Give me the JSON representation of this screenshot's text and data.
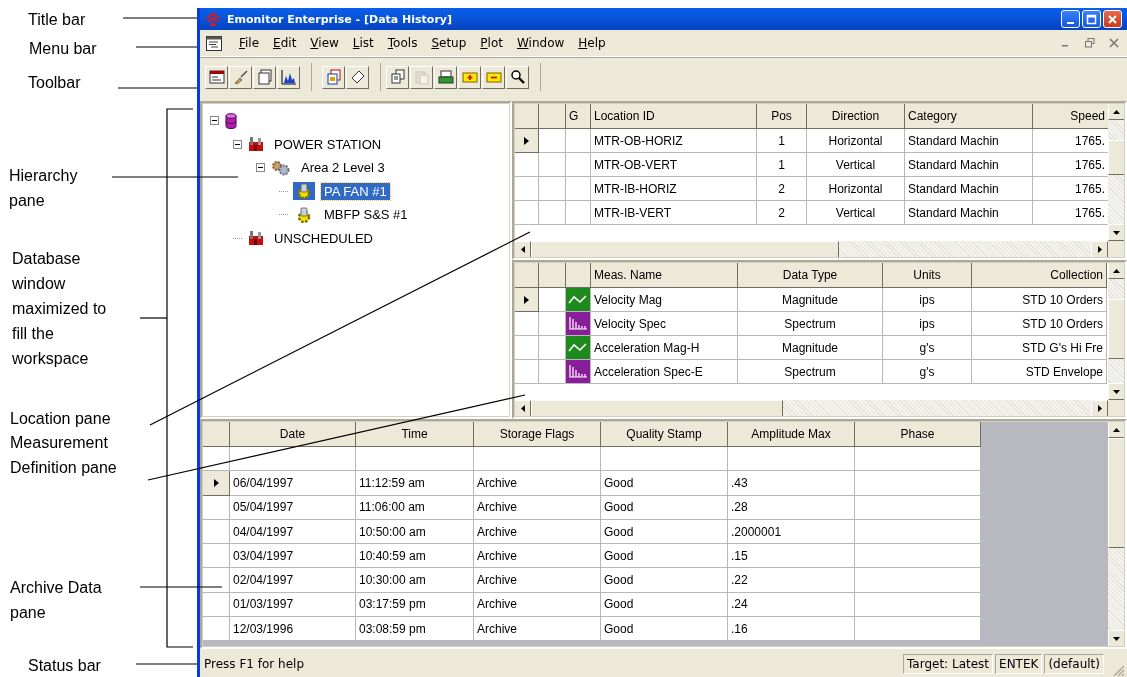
{
  "annotations": [
    {
      "label": "Title bar"
    },
    {
      "label": "Menu bar"
    },
    {
      "label": "Toolbar"
    },
    {
      "label": "Hierarchy pane"
    },
    {
      "label": "Database window maximized to fill the workspace"
    },
    {
      "label": "Location pane"
    },
    {
      "label": "Measurement Definition pane"
    },
    {
      "label": "Archive Data pane"
    },
    {
      "label": "Status bar"
    }
  ],
  "window": {
    "title": "Emonitor Enterprise - [Data History]"
  },
  "menu": [
    {
      "label": "File"
    },
    {
      "label": "Edit"
    },
    {
      "label": "View"
    },
    {
      "label": "List"
    },
    {
      "label": "Tools"
    },
    {
      "label": "Setup"
    },
    {
      "label": "Plot"
    },
    {
      "label": "Window"
    },
    {
      "label": "Help"
    }
  ],
  "toolbar": {
    "groups": [
      {
        "buttons": [
          {
            "disabled": false
          },
          {
            "disabled": false
          },
          {
            "disabled": false
          },
          {
            "disabled": false
          }
        ]
      },
      {
        "buttons": [
          {
            "disabled": false
          },
          {
            "disabled": false
          }
        ]
      },
      {
        "buttons": [
          {
            "disabled": false
          },
          {
            "disabled": true
          },
          {
            "disabled": false
          },
          {
            "disabled": false
          },
          {
            "disabled": false
          },
          {
            "disabled": false
          }
        ]
      }
    ]
  },
  "tree": {
    "nodes": [
      {
        "kind": "database",
        "expanded": true,
        "selected": false,
        "children": [
          {
            "label": "POWER STATION",
            "kind": "plant",
            "expanded": true,
            "selected": false,
            "children": [
              {
                "label": "Area 2 Level 3",
                "kind": "area",
                "expanded": true,
                "selected": false,
                "children": [
                  {
                    "label": "PA FAN #1",
                    "kind": "machine",
                    "selected": true
                  },
                  {
                    "label": "MBFP S&S #1",
                    "kind": "machine",
                    "selected": false
                  }
                ]
              }
            ]
          },
          {
            "label": "UNSCHEDULED",
            "kind": "plant",
            "selected": false
          }
        ]
      }
    ]
  },
  "location": {
    "columns": [
      "G",
      "Location ID",
      "Pos",
      "Direction",
      "Category",
      "Speed"
    ],
    "rows": [
      {
        "current": true,
        "cells": [
          "",
          "MTR-OB-HORIZ",
          "1",
          "Horizontal",
          "Standard Machin",
          "1765."
        ]
      },
      {
        "current": false,
        "cells": [
          "",
          "MTR-OB-VERT",
          "1",
          "Vertical",
          "Standard Machin",
          "1765."
        ]
      },
      {
        "current": false,
        "cells": [
          "",
          "MTR-IB-HORIZ",
          "2",
          "Horizontal",
          "Standard Machin",
          "1765."
        ]
      },
      {
        "current": false,
        "cells": [
          "",
          "MTR-IB-VERT",
          "2",
          "Vertical",
          "Standard Machin",
          "1765."
        ]
      }
    ]
  },
  "measurement": {
    "columns": [
      "Meas. Name",
      "Data Type",
      "Units",
      "Collection"
    ],
    "rows": [
      {
        "current": true,
        "kind": "magnitude",
        "cells": [
          "Velocity Mag",
          "Magnitude",
          "ips",
          "STD 10 Orders"
        ]
      },
      {
        "current": false,
        "kind": "spectrum",
        "cells": [
          "Velocity Spec",
          "Spectrum",
          "ips",
          "STD 10 Orders"
        ]
      },
      {
        "current": false,
        "kind": "magnitude",
        "cells": [
          "Acceleration Mag-H",
          "Magnitude",
          "g's",
          "STD G's Hi Fre"
        ]
      },
      {
        "current": false,
        "kind": "spectrum",
        "cells": [
          "Acceleration Spec-E",
          "Spectrum",
          "g's",
          "STD Envelope"
        ]
      }
    ]
  },
  "archive": {
    "columns": [
      "Date",
      "Time",
      "Storage Flags",
      "Quality Stamp",
      "Amplitude Max",
      "Phase"
    ],
    "rows": [
      {
        "current": false
      },
      {
        "current": true,
        "cells": [
          "06/04/1997",
          "11:12:59 am",
          "Archive",
          "Good",
          ".43"
        ]
      },
      {
        "current": false,
        "cells": [
          "05/04/1997",
          "11:06:00 am",
          "Archive",
          "Good",
          ".28"
        ]
      },
      {
        "current": false,
        "cells": [
          "04/04/1997",
          "10:50:00 am",
          "Archive",
          "Good",
          ".2000001"
        ]
      },
      {
        "current": false,
        "cells": [
          "03/04/1997",
          "10:40:59 am",
          "Archive",
          "Good",
          ".15"
        ]
      },
      {
        "current": false,
        "cells": [
          "02/04/1997",
          "10:30:00 am",
          "Archive",
          "Good",
          ".22"
        ]
      },
      {
        "current": false,
        "cells": [
          "01/03/1997",
          "03:17:59 pm",
          "Archive",
          "Good",
          ".24"
        ]
      },
      {
        "current": false,
        "cells": [
          "12/03/1996",
          "03:08:59 pm",
          "Archive",
          "Good",
          ".16"
        ]
      }
    ]
  },
  "status_bar": {
    "message": "Press F1 for help",
    "panels": [
      "Target: Latest",
      "ENTEK",
      "(default)"
    ]
  }
}
